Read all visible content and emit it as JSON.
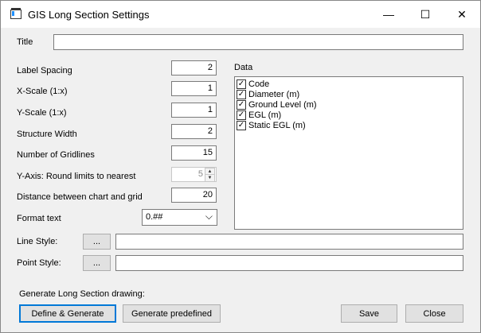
{
  "window": {
    "title": "GIS Long Section Settings",
    "minimize_glyph": "—",
    "maximize_glyph": "☐",
    "close_glyph": "✕"
  },
  "form": {
    "title_label": "Title",
    "title_value": "",
    "label_spacing_label": "Label Spacing",
    "label_spacing_value": "2",
    "xscale_label": "X-Scale (1:x)",
    "xscale_value": "1",
    "yscale_label": "Y-Scale (1:x)",
    "yscale_value": "1",
    "structure_width_label": "Structure Width",
    "structure_width_value": "2",
    "gridlines_label": "Number of Gridlines",
    "gridlines_value": "15",
    "round_limits_label": "Y-Axis: Round limits to nearest",
    "round_limits_value": "5",
    "distance_label": "Distance between chart and grid",
    "distance_value": "20",
    "format_label": "Format text",
    "format_value": "0.##",
    "line_style_label": "Line Style:",
    "line_style_button": "...",
    "line_style_value": "",
    "point_style_label": "Point Style:",
    "point_style_button": "...",
    "point_style_value": ""
  },
  "data_panel": {
    "label": "Data",
    "items": [
      {
        "label": "Code",
        "checked": true
      },
      {
        "label": "Diameter (m)",
        "checked": true
      },
      {
        "label": "Ground Level (m)",
        "checked": true
      },
      {
        "label": "EGL (m)",
        "checked": true
      },
      {
        "label": "Static EGL (m)",
        "checked": true
      }
    ]
  },
  "footer": {
    "generate_caption": "Generate Long Section drawing:",
    "define_generate": "Define & Generate",
    "generate_predefined": "Generate predefined",
    "save": "Save",
    "close": "Close"
  },
  "icons": {
    "check": "✓",
    "chevron_down": "⌵",
    "spin_up": "▲",
    "spin_down": "▼"
  }
}
